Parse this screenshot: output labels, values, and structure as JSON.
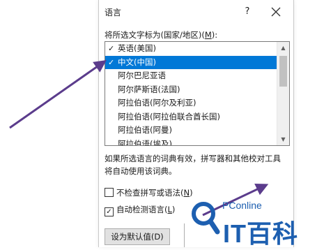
{
  "dialog": {
    "title": "语言",
    "help_label": "?",
    "list_label_prefix": "将所选文字标为(国家/地区)(",
    "list_label_key": "M",
    "list_label_suffix": "):",
    "languages": [
      {
        "label": "英语(美国)",
        "mark": "ABC✓"
      },
      {
        "label": "中文(中国)",
        "mark": "ABC✓",
        "selected": true
      },
      {
        "label": "阿尔巴尼亚语"
      },
      {
        "label": "阿尔萨斯语(法国)"
      },
      {
        "label": "阿拉伯语(阿尔及利亚)"
      },
      {
        "label": "阿拉伯语(阿拉伯联合酋长国)"
      },
      {
        "label": "阿拉伯语(阿曼)"
      },
      {
        "label": "阿拉伯语(埃及)"
      }
    ],
    "description": "如果所选语言的词典有效，拼写器和其他校对工具将自动使用该词典。",
    "no_proofing": {
      "label": "不检查拼写或语法(",
      "key": "N",
      "suffix": ")",
      "checked": false
    },
    "detect_language": {
      "label": "自动检测语言(",
      "key": "L",
      "suffix": ")",
      "checked": true
    },
    "default_button": "设为默认值(D)"
  },
  "annotation": {
    "arrow_color": "#5b3c8c"
  },
  "watermark": {
    "brand": "PConline",
    "name": "IT百科",
    "color": "#1d5fb0"
  }
}
